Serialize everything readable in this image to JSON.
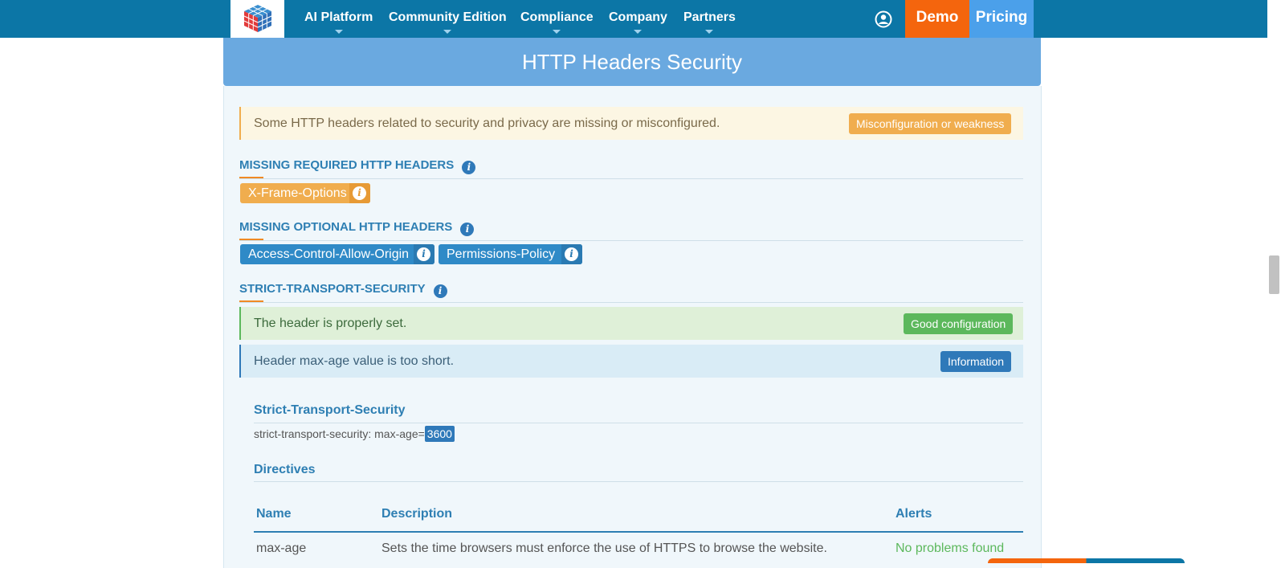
{
  "navbar": {
    "items": [
      {
        "label": "AI Platform"
      },
      {
        "label": "Community Edition"
      },
      {
        "label": "Compliance"
      },
      {
        "label": "Company"
      },
      {
        "label": "Partners"
      }
    ],
    "demo_label": "Demo",
    "pricing_label": "Pricing",
    "accent": "#0c76a6"
  },
  "panel": {
    "title": "HTTP Headers Security",
    "warning_text": "Some HTTP headers related to security and privacy are missing or misconfigured.",
    "warning_badge": "Misconfiguration or weakness"
  },
  "missing_required": {
    "title": "MISSING REQUIRED HTTP HEADERS",
    "headers": [
      "X-Frame-Options"
    ]
  },
  "missing_optional": {
    "title": "MISSING OPTIONAL HTTP HEADERS",
    "headers": [
      "Access-Control-Allow-Origin",
      "Permissions-Policy"
    ]
  },
  "hsts": {
    "title": "STRICT-TRANSPORT-SECURITY",
    "success_text": "The header is properly set.",
    "success_badge": "Good configuration",
    "info_text": "Header max-age value is too short.",
    "info_badge": "Information",
    "header_name": "Strict-Transport-Security",
    "raw_prefix": "strict-transport-security: max-age=",
    "raw_value": "3600",
    "directives_title": "Directives",
    "table": {
      "columns": [
        "Name",
        "Description",
        "Alerts"
      ],
      "rows": [
        {
          "name": "max-age",
          "description": "Sets the time browsers must enforce the use of HTTPS to browse the website.",
          "alert": "No problems found"
        }
      ]
    }
  },
  "icons": {
    "info": "i"
  }
}
